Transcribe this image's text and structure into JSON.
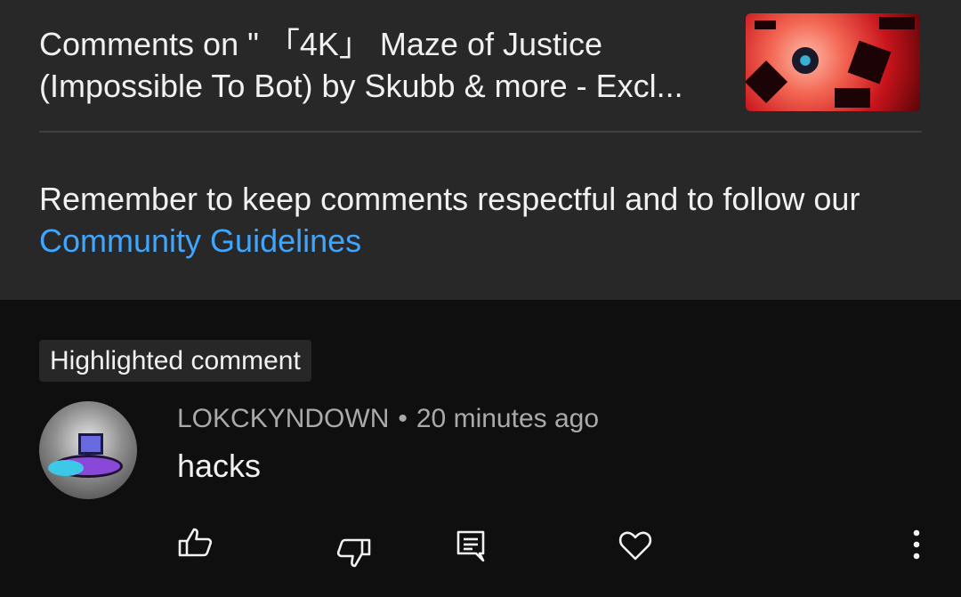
{
  "header": {
    "title": "Comments on \" 「4K」 Maze of Justice (Impossible To Bot) by Skubb & more - Excl...",
    "reminder_prefix": "Remember to keep comments respectful and to follow our ",
    "reminder_link": "Community Guidelines"
  },
  "comment": {
    "badge": "Highlighted comment",
    "author": "LOKCKYNDOWN",
    "separator": "•",
    "time": "20 minutes ago",
    "text": "hacks"
  },
  "actions": {
    "icons": [
      "thumbs-up-icon",
      "thumbs-down-icon",
      "reply-icon",
      "heart-icon",
      "more-vertical-icon"
    ]
  },
  "colors": {
    "header_bg": "#282828",
    "page_bg": "#0f0f0f",
    "link": "#3ea6ff",
    "secondary_text": "#aaaaaa"
  }
}
